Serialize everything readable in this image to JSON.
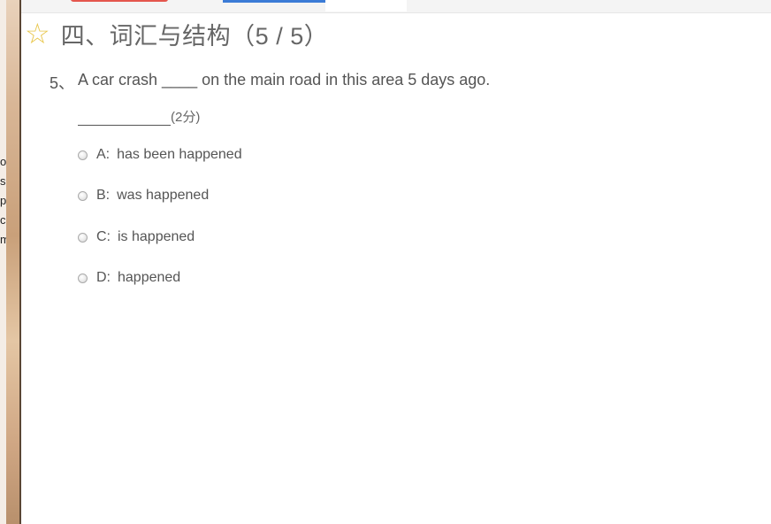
{
  "background": {
    "strip_text": [
      "o",
      "s",
      "p",
      "ca",
      "m"
    ]
  },
  "section": {
    "star_icon": "star-outline-icon",
    "title": "四、词汇与结构（5 / 5）"
  },
  "question": {
    "number": "5、",
    "text": "A car crash ____ on the main road in this area 5 days ago.",
    "points": "(2分)"
  },
  "options": [
    {
      "key": "A:",
      "text": "has been happened"
    },
    {
      "key": "B:",
      "text": "was happened"
    },
    {
      "key": "C:",
      "text": "is happened"
    },
    {
      "key": "D:",
      "text": "happened"
    }
  ],
  "colors": {
    "star": "#e8c64a",
    "title_text": "#666666",
    "body_text": "#555555"
  }
}
